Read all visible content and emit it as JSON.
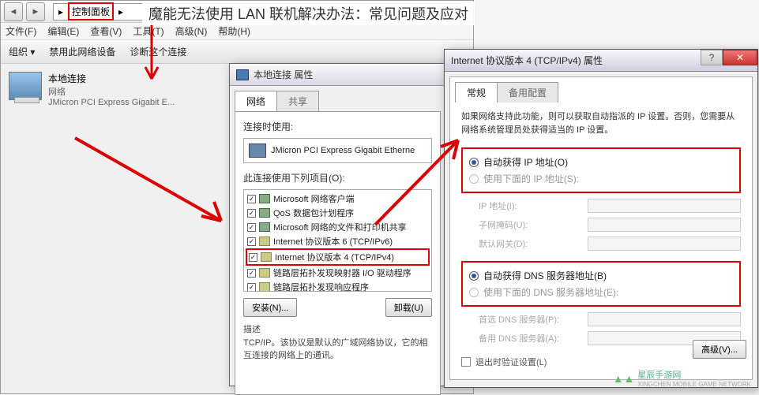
{
  "article_title": "魔能无法使用 LAN 联机解决办法：常见问题及应对",
  "nav": {
    "breadcrumb_item": "控制面板",
    "breadcrumb_sep": "▸"
  },
  "menu": {
    "file": "文件(F)",
    "edit": "编辑(E)",
    "view": "查看(V)",
    "tools": "工具(T)",
    "advanced": "高级(N)",
    "help": "帮助(H)"
  },
  "toolbar": {
    "organize": "组织 ▾",
    "disable": "禁用此网络设备",
    "diagnose": "诊断这个连接"
  },
  "connection": {
    "title": "本地连接",
    "sub1": "网络",
    "sub2": "JMicron PCI Express Gigabit E..."
  },
  "dialog1": {
    "title": "本地连接 属性",
    "tab_network": "网络",
    "tab_share": "共享",
    "connect_using": "连接时使用:",
    "adapter": "JMicron PCI Express Gigabit Etherne",
    "items_label": "此连接使用下列项目(O):",
    "items": [
      "Microsoft 网络客户端",
      "QoS 数据包计划程序",
      "Microsoft 网络的文件和打印机共享",
      "Internet 协议版本 6 (TCP/IPv6)",
      "Internet 协议版本 4 (TCP/IPv4)",
      "链路层拓扑发现映射器 I/O 驱动程序",
      "链路层拓扑发现响应程序"
    ],
    "install": "安装(N)...",
    "uninstall": "卸载(U)",
    "desc_title": "描述",
    "desc_text": "TCP/IP。该协议是默认的广域网络协议，它的相互连接的网络上的通讯。"
  },
  "dialog2": {
    "title": "Internet 协议版本 4 (TCP/IPv4) 属性",
    "tab_general": "常规",
    "tab_alt": "备用配置",
    "info": "如果网络支持此功能，则可以获取自动指派的 IP 设置。否则，您需要从网络系统管理员处获得适当的 IP 设置。",
    "auto_ip": "自动获得 IP 地址(O)",
    "manual_ip": "使用下面的 IP 地址(S):",
    "ip_addr": "IP 地址(I):",
    "subnet": "子网掩码(U):",
    "gateway": "默认网关(D):",
    "auto_dns": "自动获得 DNS 服务器地址(B)",
    "manual_dns": "使用下面的 DNS 服务器地址(E):",
    "dns1": "首选 DNS 服务器(P):",
    "dns2": "备用 DNS 服务器(A):",
    "validate": "退出时验证设置(L)",
    "advanced": "高级(V)..."
  },
  "watermark": {
    "text": "星辰手游网",
    "sub": "XINGCHEN MOBILE GAME NETWORK"
  }
}
